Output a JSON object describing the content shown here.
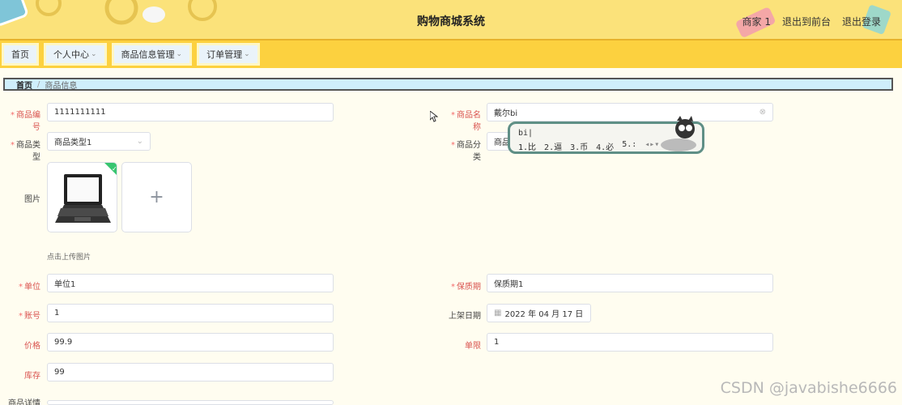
{
  "header": {
    "title": "购物商城系统",
    "user": "商家 1",
    "to_front": "退出到前台",
    "logout": "退出登录"
  },
  "nav": {
    "home": "首页",
    "personal": "个人中心",
    "goods_mgmt": "商品信息管理",
    "order_mgmt": "订单管理"
  },
  "breadcrumb": {
    "home": "首页",
    "sep": "/",
    "current": "商品信息"
  },
  "form": {
    "code_label": "商品编号",
    "code_value": "1111111111",
    "name_label": "商品名称",
    "name_value": "戴尔bi",
    "type_label": "商品类型",
    "type_value": "商品类型1",
    "category_label": "商品分类",
    "category_value": "商品",
    "image_label": "图片",
    "upload_hint": "点击上传图片",
    "upload_plus": "+",
    "unit_label": "单位",
    "unit_value": "单位1",
    "warranty_label": "保质期",
    "warranty_value": "保质期1",
    "account_label": "账号",
    "account_value": "1",
    "date_label": "上架日期",
    "date_value": "2022 年 04 月 17 日",
    "price_label": "价格",
    "price_value": "99.9",
    "limit_label": "单限",
    "limit_value": "1",
    "stock_label": "库存",
    "stock_value": "99",
    "detail_label": "商品详情"
  },
  "ime": {
    "pinyin": "bi|",
    "candidates": [
      "1.比",
      "2.逼",
      "3.币",
      "4.必",
      "5.:"
    ]
  },
  "watermark": "CSDN @javabishe6666"
}
